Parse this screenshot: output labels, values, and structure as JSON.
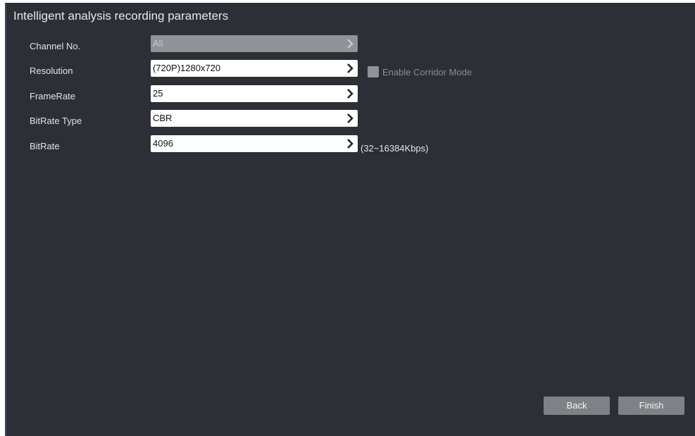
{
  "title": "Intelligent analysis recording parameters",
  "fields": [
    {
      "label": "Channel No.",
      "value": "All",
      "disabled": true
    },
    {
      "label": "Resolution",
      "value": "(720P)1280x720",
      "disabled": false
    },
    {
      "label": "FrameRate",
      "value": "25",
      "disabled": false
    },
    {
      "label": "BitRate Type",
      "value": "CBR",
      "disabled": false
    },
    {
      "label": "BitRate",
      "value": "4096",
      "disabled": false
    }
  ],
  "corridor": {
    "label": "Enable Corridor Mode",
    "checked": false,
    "enabled": false
  },
  "bitrate_hint": "(32~16384Kbps)",
  "buttons": {
    "back": "Back",
    "finish": "Finish"
  },
  "colors": {
    "panel_bg": "#2c2f35",
    "field_bg": "#ffffff",
    "field_disabled_bg": "#8f9296",
    "button_bg": "#7e8286",
    "text": "#e2e4e6"
  },
  "icons": {
    "dropdown": "chevron-right-icon"
  }
}
